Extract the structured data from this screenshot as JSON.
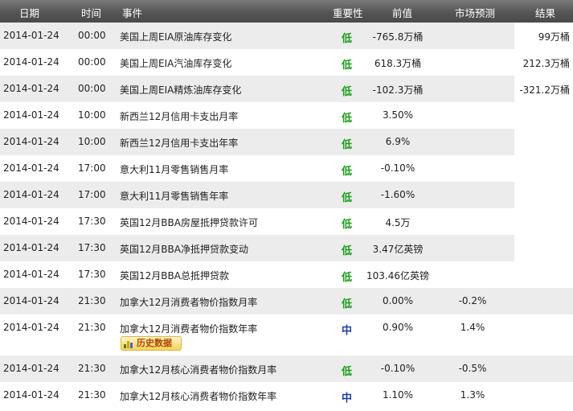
{
  "headers": {
    "date": "日期",
    "time": "时间",
    "event": "事件",
    "importance": "重要性",
    "previous": "前值",
    "forecast": "市场预测",
    "result": "结果"
  },
  "history_button": "历史数据",
  "rows": [
    {
      "date": "2014-01-24",
      "time": "00:00",
      "event": "美国上周EIA原油库存变化",
      "importance": "低",
      "previous": "-765.8万桶",
      "forecast": "",
      "result": "99万桶"
    },
    {
      "date": "2014-01-24",
      "time": "00:00",
      "event": "美国上周EIA汽油库存变化",
      "importance": "低",
      "previous": "618.3万桶",
      "forecast": "",
      "result": "212.3万桶"
    },
    {
      "date": "2014-01-24",
      "time": "00:00",
      "event": "美国上周EIA精炼油库存变化",
      "importance": "低",
      "previous": "-102.3万桶",
      "forecast": "",
      "result": "-321.2万桶"
    },
    {
      "date": "2014-01-24",
      "time": "10:00",
      "event": "新西兰12月信用卡支出月率",
      "importance": "低",
      "previous": "3.50%",
      "forecast": "",
      "result": ""
    },
    {
      "date": "2014-01-24",
      "time": "10:00",
      "event": "新西兰12月信用卡支出年率",
      "importance": "低",
      "previous": "6.9%",
      "forecast": "",
      "result": ""
    },
    {
      "date": "2014-01-24",
      "time": "17:00",
      "event": "意大利11月零售销售月率",
      "importance": "低",
      "previous": "-0.10%",
      "forecast": "",
      "result": ""
    },
    {
      "date": "2014-01-24",
      "time": "17:00",
      "event": "意大利11月零售销售年率",
      "importance": "低",
      "previous": "-1.60%",
      "forecast": "",
      "result": ""
    },
    {
      "date": "2014-01-24",
      "time": "17:30",
      "event": "英国12月BBA房屋抵押贷款许可",
      "importance": "低",
      "previous": "4.5万",
      "forecast": "",
      "result": ""
    },
    {
      "date": "2014-01-24",
      "time": "17:30",
      "event": "英国12月BBA净抵押贷款变动",
      "importance": "低",
      "previous": "3.47亿英镑",
      "forecast": "",
      "result": ""
    },
    {
      "date": "2014-01-24",
      "time": "17:30",
      "event": "英国12月BBA总抵押贷款",
      "importance": "低",
      "previous": "103.46亿英镑",
      "forecast": "",
      "result": ""
    },
    {
      "date": "2014-01-24",
      "time": "21:30",
      "event": "加拿大12月消费者物价指数月率",
      "importance": "低",
      "previous": "0.00%",
      "forecast": "-0.2%",
      "result": ""
    },
    {
      "date": "2014-01-24",
      "time": "21:30",
      "event": "加拿大12月消费者物价指数年率",
      "importance": "中",
      "previous": "0.90%",
      "forecast": "1.4%",
      "result": "",
      "has_history": true
    },
    {
      "date": "2014-01-24",
      "time": "21:30",
      "event": "加拿大12月核心消费者物价指数月率",
      "importance": "低",
      "previous": "-0.10%",
      "forecast": "-0.5%",
      "result": ""
    },
    {
      "date": "2014-01-24",
      "time": "21:30",
      "event": "加拿大12月核心消费者物价指数年率",
      "importance": "中",
      "previous": "1.10%",
      "forecast": "1.3%",
      "result": ""
    }
  ],
  "colors": {
    "header_bg": "#555555",
    "row_shade": "#ececec",
    "importance_low": "#16a016",
    "importance_mid": "#1a3fa8"
  }
}
